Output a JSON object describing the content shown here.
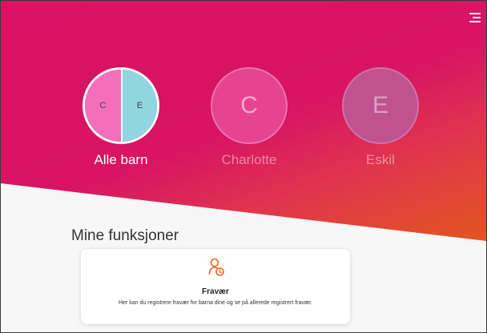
{
  "header": {
    "menu_icon": "hamburger-menu-icon"
  },
  "children": [
    {
      "label": "Alle barn",
      "left_initial": "C",
      "right_initial": "E",
      "selected": true
    },
    {
      "label": "Charlotte",
      "initial": "C",
      "selected": false
    },
    {
      "label": "Eskil",
      "initial": "E",
      "selected": false
    }
  ],
  "section": {
    "title": "Mine funksjoner"
  },
  "features": [
    {
      "icon": "person-clock-icon",
      "title": "Fravær",
      "description": "Her kan du registrere fravær for barna dine og se på allerede registrert fravær."
    }
  ],
  "colors": {
    "brand": "#db1165",
    "gradient_end": "#e3561f",
    "icon_accent": "#e8661f",
    "alle_barn_left": "#f36fb9",
    "alle_barn_right": "#8fd6e0"
  }
}
